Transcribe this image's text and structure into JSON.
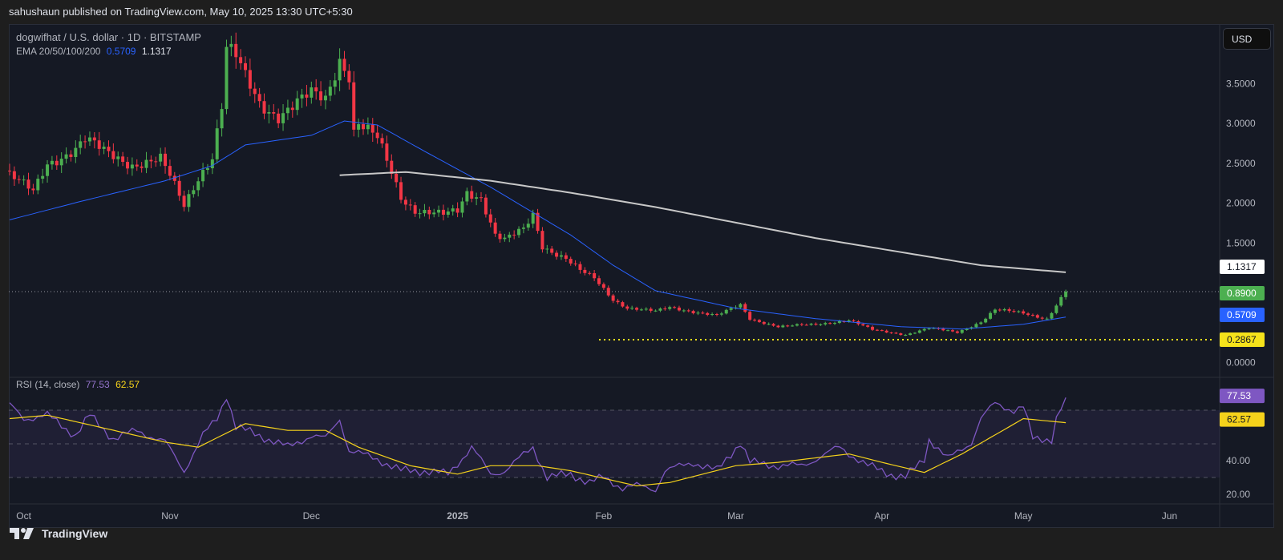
{
  "published": "sahushaun published on TradingView.com, May 10, 2025 13:30 UTC+5:30",
  "legend": {
    "symbol": "dogwifhat / U.S. dollar · 1D · BITSTAMP",
    "ema_label": "EMA 20/50/100/200",
    "ema50_value": "0.5709",
    "ema200_value": "1.1317",
    "rsi_label": "RSI (14, close)",
    "rsi_value": "77.53",
    "rsi_ma_value": "62.57"
  },
  "currency_button": "USD",
  "brand": "TradingView",
  "colors": {
    "up": "#4caf50",
    "down": "#f23645",
    "ema50": "#2962ff",
    "ema200": "#c8c8c8",
    "rsi": "#7e57c2",
    "rsi_ma": "#f5d21b",
    "support": "#f5e21b"
  },
  "chart_data": [
    {
      "type": "candlestick",
      "title": "dogwifhat / U.S. dollar · 1D · BITSTAMP",
      "x_unit": "days since 2024-09-28",
      "ylim": [
        0,
        4.3
      ],
      "y_ticks": [
        "0.0000",
        "1.5000",
        "2.0000",
        "2.5000",
        "3.0000",
        "3.5000"
      ],
      "y_tick_values": [
        0,
        1.5,
        2.0,
        2.5,
        3.0,
        3.5
      ],
      "x_ticks": [
        {
          "label": "Oct",
          "day": 3
        },
        {
          "label": "Nov",
          "day": 34
        },
        {
          "label": "Dec",
          "day": 64
        },
        {
          "label": "2025",
          "day": 95
        },
        {
          "label": "Feb",
          "day": 126
        },
        {
          "label": "Mar",
          "day": 154
        },
        {
          "label": "Apr",
          "day": 185
        },
        {
          "label": "May",
          "day": 215
        },
        {
          "label": "Jun",
          "day": 246
        }
      ],
      "close_keypoints": [
        [
          0,
          2.36
        ],
        [
          5,
          2.13
        ],
        [
          8,
          2.49
        ],
        [
          14,
          2.69
        ],
        [
          16,
          2.8
        ],
        [
          20,
          2.64
        ],
        [
          26,
          2.49
        ],
        [
          32,
          2.54
        ],
        [
          34,
          2.33
        ],
        [
          37,
          1.97
        ],
        [
          40,
          2.33
        ],
        [
          43,
          2.59
        ],
        [
          45,
          3.21
        ],
        [
          46,
          3.93
        ],
        [
          48,
          3.82
        ],
        [
          50,
          3.57
        ],
        [
          53,
          3.26
        ],
        [
          57,
          3.1
        ],
        [
          60,
          3.21
        ],
        [
          64,
          3.36
        ],
        [
          67,
          3.31
        ],
        [
          70,
          3.82
        ],
        [
          72,
          3.62
        ],
        [
          73,
          2.9
        ],
        [
          74,
          3.0
        ],
        [
          78,
          2.8
        ],
        [
          81,
          2.38
        ],
        [
          83,
          2.08
        ],
        [
          86,
          1.92
        ],
        [
          92,
          1.85
        ],
        [
          95,
          1.89
        ],
        [
          97,
          2.13
        ],
        [
          100,
          2.08
        ],
        [
          103,
          1.61
        ],
        [
          105,
          1.54
        ],
        [
          109,
          1.66
        ],
        [
          111,
          1.85
        ],
        [
          113,
          1.46
        ],
        [
          118,
          1.31
        ],
        [
          121,
          1.15
        ],
        [
          124,
          1.05
        ],
        [
          128,
          0.79
        ],
        [
          131,
          0.69
        ],
        [
          137,
          0.64
        ],
        [
          140,
          0.69
        ],
        [
          145,
          0.64
        ],
        [
          150,
          0.59
        ],
        [
          155,
          0.72
        ],
        [
          157,
          0.55
        ],
        [
          163,
          0.45
        ],
        [
          171,
          0.48
        ],
        [
          178,
          0.53
        ],
        [
          183,
          0.41
        ],
        [
          190,
          0.35
        ],
        [
          195,
          0.43
        ],
        [
          201,
          0.38
        ],
        [
          206,
          0.51
        ],
        [
          209,
          0.66
        ],
        [
          215,
          0.62
        ],
        [
          220,
          0.55
        ],
        [
          222,
          0.72
        ],
        [
          224,
          0.89
        ]
      ],
      "ema50_keypoints": [
        [
          0,
          1.79
        ],
        [
          15,
          2.02
        ],
        [
          33,
          2.28
        ],
        [
          43,
          2.47
        ],
        [
          50,
          2.73
        ],
        [
          64,
          2.85
        ],
        [
          71,
          3.03
        ],
        [
          78,
          2.98
        ],
        [
          88,
          2.65
        ],
        [
          102,
          2.2
        ],
        [
          119,
          1.6
        ],
        [
          128,
          1.22
        ],
        [
          137,
          0.9
        ],
        [
          154,
          0.68
        ],
        [
          171,
          0.55
        ],
        [
          189,
          0.45
        ],
        [
          202,
          0.42
        ],
        [
          215,
          0.48
        ],
        [
          224,
          0.5709
        ]
      ],
      "ema200_keypoints": [
        [
          70,
          2.35
        ],
        [
          84,
          2.39
        ],
        [
          102,
          2.28
        ],
        [
          119,
          2.13
        ],
        [
          137,
          1.95
        ],
        [
          171,
          1.56
        ],
        [
          206,
          1.22
        ],
        [
          224,
          1.1317
        ]
      ],
      "last_price": 0.89,
      "last_price_label": "0.8900",
      "ema200_label": "1.1317",
      "ema50_label": "0.5709",
      "support_level": 0.2867,
      "support_label": "0.2867",
      "support_start_day": 125
    },
    {
      "type": "line",
      "title": "RSI (14, close)",
      "ylim": [
        20,
        80
      ],
      "y_ticks": [
        "20.00",
        "40.00"
      ],
      "y_tick_values": [
        20,
        40
      ],
      "bands": [
        30,
        50,
        70
      ],
      "rsi_keypoints": [
        [
          0,
          73
        ],
        [
          3,
          65
        ],
        [
          8,
          67
        ],
        [
          14,
          55
        ],
        [
          17,
          67
        ],
        [
          22,
          53
        ],
        [
          27,
          58
        ],
        [
          33,
          51
        ],
        [
          37,
          34
        ],
        [
          41,
          55
        ],
        [
          44,
          65
        ],
        [
          46,
          79
        ],
        [
          48,
          60
        ],
        [
          53,
          55
        ],
        [
          59,
          48
        ],
        [
          64,
          55
        ],
        [
          67,
          53
        ],
        [
          70,
          65
        ],
        [
          72,
          46
        ],
        [
          78,
          41
        ],
        [
          83,
          34
        ],
        [
          88,
          34
        ],
        [
          93,
          32
        ],
        [
          98,
          48
        ],
        [
          102,
          32
        ],
        [
          105,
          34
        ],
        [
          111,
          48
        ],
        [
          114,
          30
        ],
        [
          119,
          32
        ],
        [
          123,
          27
        ],
        [
          126,
          30
        ],
        [
          130,
          24
        ],
        [
          133,
          25
        ],
        [
          137,
          23
        ],
        [
          139,
          34
        ],
        [
          145,
          39
        ],
        [
          150,
          34
        ],
        [
          155,
          51
        ],
        [
          157,
          39
        ],
        [
          163,
          37
        ],
        [
          168,
          37
        ],
        [
          171,
          41
        ],
        [
          176,
          48
        ],
        [
          182,
          37
        ],
        [
          187,
          32
        ],
        [
          190,
          30
        ],
        [
          194,
          41
        ],
        [
          195,
          53
        ],
        [
          199,
          41
        ],
        [
          204,
          51
        ],
        [
          206,
          65
        ],
        [
          209,
          74
        ],
        [
          213,
          70
        ],
        [
          215,
          72
        ],
        [
          217,
          53
        ],
        [
          221,
          53
        ],
        [
          222,
          65
        ],
        [
          224,
          77.53
        ]
      ],
      "rsi_ma_keypoints": [
        [
          0,
          65
        ],
        [
          8,
          67
        ],
        [
          19,
          60
        ],
        [
          33,
          51
        ],
        [
          40,
          48
        ],
        [
          50,
          62
        ],
        [
          59,
          58
        ],
        [
          67,
          58
        ],
        [
          74,
          48
        ],
        [
          85,
          37
        ],
        [
          95,
          32
        ],
        [
          102,
          37
        ],
        [
          112,
          37
        ],
        [
          119,
          34
        ],
        [
          133,
          25
        ],
        [
          140,
          27
        ],
        [
          154,
          37
        ],
        [
          163,
          39
        ],
        [
          178,
          44
        ],
        [
          185,
          39
        ],
        [
          194,
          33
        ],
        [
          202,
          44
        ],
        [
          215,
          65
        ],
        [
          224,
          62.57
        ]
      ],
      "rsi_label": "77.53",
      "rsi_ma_label": "62.57"
    }
  ]
}
